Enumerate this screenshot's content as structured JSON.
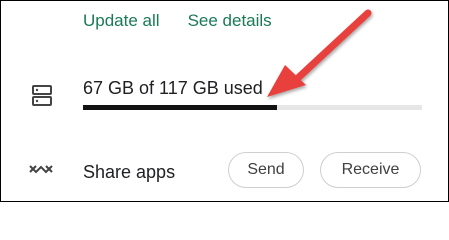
{
  "actions": {
    "update_all": "Update all",
    "see_details": "See details"
  },
  "storage": {
    "label": "67 GB of 117 GB used",
    "used_gb": 67,
    "total_gb": 117,
    "used_fraction": 0.573
  },
  "share": {
    "label": "Share apps",
    "send_label": "Send",
    "receive_label": "Receive"
  },
  "icons": {
    "storage": "storage-icon",
    "share": "share-apps-icon",
    "annotation": "red-arrow"
  },
  "colors": {
    "link": "#1a7a55",
    "progress_fill": "#121212",
    "progress_track": "#e6e6e6",
    "arrow": "#e8413c"
  }
}
